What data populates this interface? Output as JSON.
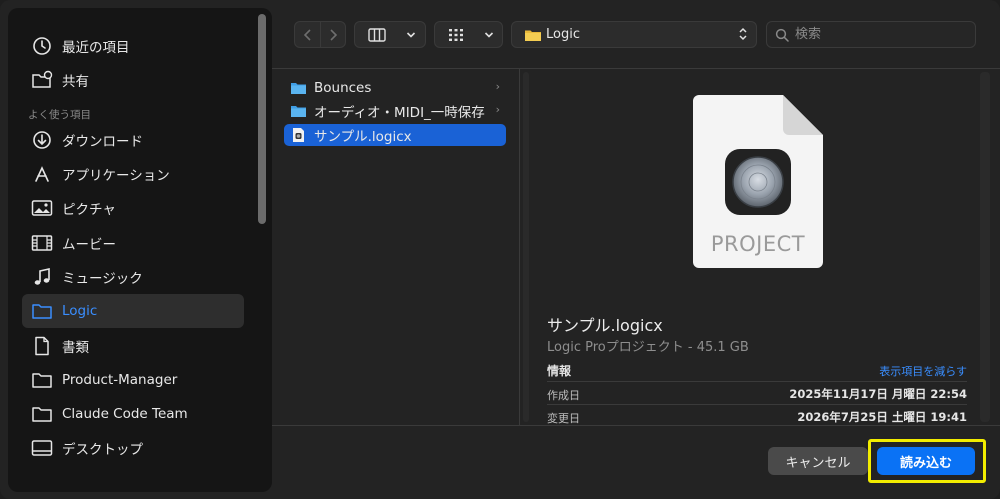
{
  "sidebar": {
    "items_top": [
      {
        "label": "最近の項目",
        "icon": "clock-icon"
      },
      {
        "label": "共有",
        "icon": "shared-folder-icon"
      }
    ],
    "section_label": "よく使う項目",
    "items": [
      {
        "label": "ダウンロード",
        "icon": "download-icon"
      },
      {
        "label": "アプリケーション",
        "icon": "applications-icon"
      },
      {
        "label": "ピクチャ",
        "icon": "photo-icon"
      },
      {
        "label": "ムービー",
        "icon": "film-icon"
      },
      {
        "label": "ミュージック",
        "icon": "music-note-icon"
      },
      {
        "label": "Logic",
        "icon": "folder-icon",
        "selected": true
      },
      {
        "label": "書類",
        "icon": "document-icon"
      },
      {
        "label": "Product-Manager",
        "icon": "folder-icon"
      },
      {
        "label": "Claude Code Team",
        "icon": "folder-icon"
      },
      {
        "label": "デスクトップ",
        "icon": "desktop-icon"
      }
    ]
  },
  "toolbar": {
    "path_label": "Logic",
    "search_placeholder": "検索"
  },
  "files": [
    {
      "label": "Bounces",
      "type": "folder"
    },
    {
      "label": "オーディオ・MIDI_一時保存",
      "type": "folder"
    },
    {
      "label": "サンプル.logicx",
      "type": "file",
      "selected": true
    }
  ],
  "preview": {
    "icon_caption": "PROJECT",
    "name": "サンプル.logicx",
    "kind": "Logic Proプロジェクト - 45.1 GB",
    "info_label": "情報",
    "show_less": "表示項目を減らす",
    "rows": [
      {
        "key": "作成日",
        "value": "2025年11月17日 月曜日 22:54"
      },
      {
        "key": "変更日",
        "value": "2026年7月25日 土曜日 19:41"
      }
    ]
  },
  "buttons": {
    "cancel": "キャンセル",
    "open": "読み込む"
  },
  "colors": {
    "accent": "#0a72f5",
    "selection": "#1a62d6",
    "highlight": "#f2ec00",
    "folder": "#5ab4f0"
  }
}
